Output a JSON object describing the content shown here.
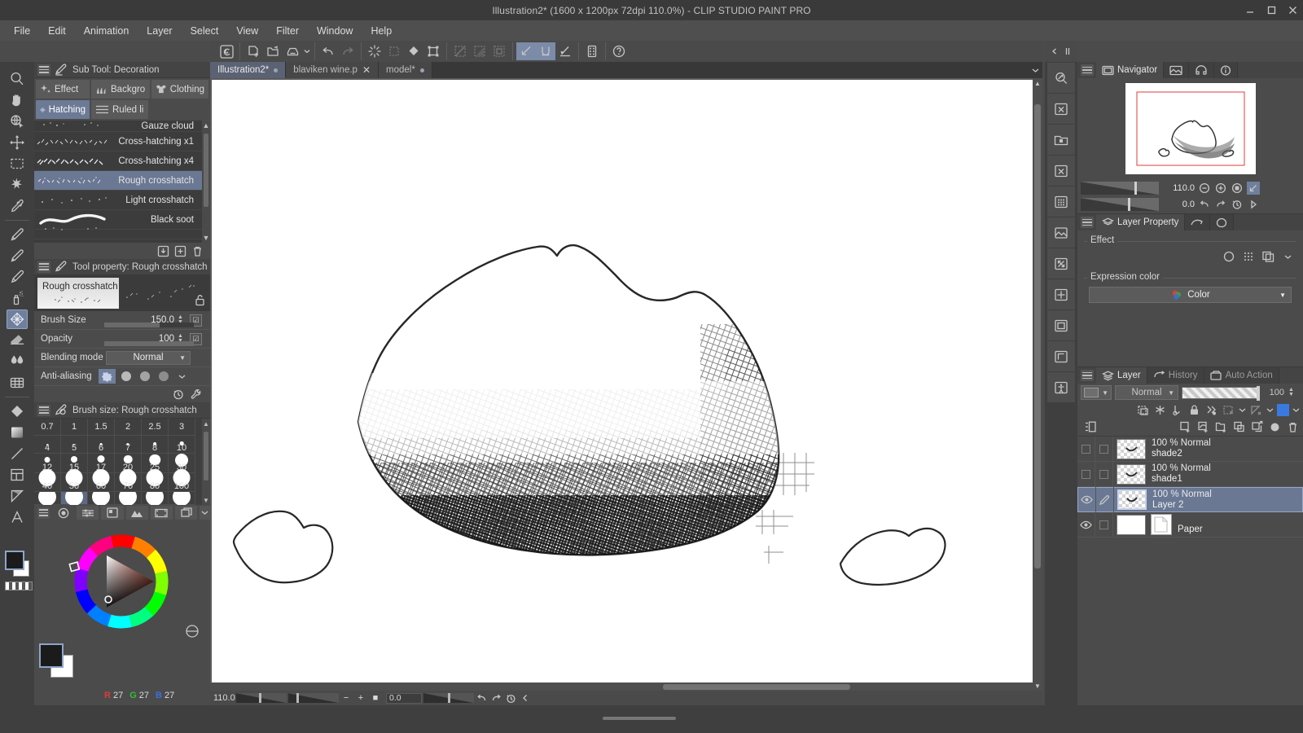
{
  "window": {
    "title": "Illustration2* (1600 x 1200px 72dpi 110.0%)  - CLIP STUDIO PAINT PRO",
    "minimize": "—",
    "maximize": "❐",
    "close": "✕"
  },
  "menubar": {
    "items": [
      "File",
      "Edit",
      "Animation",
      "Layer",
      "Select",
      "View",
      "Filter",
      "Window",
      "Help"
    ]
  },
  "doc_tabs": [
    {
      "label": "Illustration2*",
      "modified": true,
      "active": true,
      "closable": false
    },
    {
      "label": "blaviken wine.p",
      "modified": false,
      "active": false,
      "closable": true
    },
    {
      "label": "model*",
      "modified": true,
      "active": false,
      "closable": false
    }
  ],
  "command_bar": {
    "icons": [
      "clip-studio-logo-icon",
      "new-file-icon",
      "open-file-icon",
      "save-icon",
      "save-dropdown-caret-icon",
      "undo-icon",
      "redo-icon",
      "clear-icon",
      "fill-selection-icon",
      "fill-icon",
      "scale-rotate-icon",
      "selection-deselect-icon",
      "selection-invert-icon",
      "selection-border-icon",
      "select-layer-icon",
      "quick-mask-icon",
      "transparent-pixel-icon",
      "grid-icon",
      "help-icon"
    ]
  },
  "left_tools": {
    "items": [
      {
        "name": "zoom-tool",
        "icon": "magnifier-icon",
        "selected": false
      },
      {
        "name": "hand-tool",
        "icon": "hand-icon",
        "selected": false
      },
      {
        "name": "rotate-tool",
        "icon": "rotate-icon",
        "selected": false
      },
      {
        "name": "move-layer-tool",
        "icon": "move-arrows-icon",
        "selected": false
      },
      {
        "name": "selection-tool",
        "icon": "marquee-icon",
        "selected": false
      },
      {
        "name": "auto-select-tool",
        "icon": "magic-wand-icon",
        "selected": false
      },
      {
        "name": "eyedropper-tool",
        "icon": "eyedropper-icon",
        "selected": false
      },
      {
        "name": "pen-tool",
        "icon": "pen-icon",
        "selected": false
      },
      {
        "name": "pencil-tool",
        "icon": "pencil-icon",
        "selected": false
      },
      {
        "name": "brush-tool",
        "icon": "paintbrush-icon",
        "selected": false
      },
      {
        "name": "airbrush-tool",
        "icon": "airbrush-icon",
        "selected": false
      },
      {
        "name": "decoration-tool",
        "icon": "decoration-hatch-icon",
        "selected": true
      },
      {
        "name": "eraser-tool",
        "icon": "eraser-icon",
        "selected": false
      },
      {
        "name": "blend-tool",
        "icon": "blend-drops-icon",
        "selected": false
      },
      {
        "name": "gradient-tool",
        "icon": "gradient-grid-icon",
        "selected": false
      },
      {
        "name": "fill-tool",
        "icon": "fill-bucket-icon",
        "selected": false
      },
      {
        "name": "gradient-fill-tool",
        "icon": "gradient-square-icon",
        "selected": false
      },
      {
        "name": "figure-line-tool",
        "icon": "line-icon",
        "selected": false
      },
      {
        "name": "frame-border-tool",
        "icon": "frame-icon",
        "selected": false
      },
      {
        "name": "ruler-tool",
        "icon": "ruler-icon",
        "selected": false
      },
      {
        "name": "text-tool",
        "icon": "text-a-icon",
        "selected": false
      }
    ]
  },
  "subtool_panel": {
    "title": "Sub Tool: Decoration",
    "groups": [
      {
        "label": "Effect",
        "icon": "sparkle-icon",
        "selected": false
      },
      {
        "label": "Backgro",
        "icon": "grass-icon",
        "selected": false
      },
      {
        "label": "Clothing",
        "icon": "clothing-icon",
        "selected": false
      },
      {
        "label": "Hatching",
        "icon": "hatch-icon",
        "selected": true
      },
      {
        "label": "Ruled li",
        "icon": "ruled-lines-icon",
        "selected": false
      }
    ],
    "items": [
      {
        "label": "Gauze cloud",
        "selected": false,
        "partial": true
      },
      {
        "label": "Cross-hatching x1",
        "selected": false
      },
      {
        "label": "Cross-hatching x4",
        "selected": false
      },
      {
        "label": "Rough crosshatch",
        "selected": true
      },
      {
        "label": "Light crosshatch",
        "selected": false
      },
      {
        "label": "Black soot",
        "selected": false
      }
    ],
    "footer_icons": [
      "import-subtool-icon",
      "duplicate-subtool-icon",
      "delete-subtool-icon"
    ]
  },
  "tool_property": {
    "title": "Tool property: Rough crosshatch",
    "preview_label": "Rough crosshatch",
    "lock_icon": "lock-open-icon",
    "rows": [
      {
        "label": "Brush Size",
        "value": "150.0",
        "fill": 0.62,
        "type": "slider"
      },
      {
        "label": "Opacity",
        "value": "100",
        "fill": 1.0,
        "type": "slider"
      },
      {
        "label": "Blending mode",
        "value": "Normal",
        "type": "combo"
      },
      {
        "label": "Anti-aliasing",
        "type": "aa",
        "selected_index": 0
      }
    ],
    "footer_icons": [
      "history-reset-icon",
      "wrench-settings-icon"
    ]
  },
  "brush_size_panel": {
    "title": "Brush size: Rough crosshatch",
    "rows": [
      {
        "labels": [
          "0.7",
          "1",
          "1.5",
          "2",
          "2.5",
          "3"
        ],
        "dots": [
          0,
          0,
          0,
          0,
          0,
          0
        ],
        "text_only": true
      },
      {
        "labels": [
          "4",
          "5",
          "6",
          "7",
          "8",
          "10"
        ],
        "dots": [
          2,
          2.4,
          2.8,
          3.2,
          3.8,
          4.6
        ]
      },
      {
        "labels": [
          "12",
          "15",
          "17",
          "20",
          "25",
          "30"
        ],
        "dots": [
          7,
          8,
          9,
          10.5,
          13.5,
          16
        ]
      },
      {
        "labels": [
          "40",
          "50",
          "60",
          "70",
          "80",
          "100"
        ],
        "dots": [
          19,
          19,
          19,
          19,
          19,
          19
        ]
      },
      {
        "labels": [
          "",
          "",
          "",
          "",
          "",
          ""
        ],
        "dots": [
          19,
          19,
          19,
          19,
          19,
          19
        ],
        "selected_index": 1
      }
    ]
  },
  "color_panel": {
    "tabs": [
      "color-wheel-icon",
      "color-slider-icon",
      "color-set-icon",
      "gradient-icon",
      "filmstrip-icon",
      "layers-stack-icon"
    ],
    "main_color": "#000000",
    "sub_color": "#ffffff",
    "rgb": {
      "r": "27",
      "g": "27",
      "b": "27"
    },
    "rgb_labels": {
      "r": "R",
      "g": "G",
      "b": "B"
    }
  },
  "canvas": {
    "artwork_name": "hatched-rock-drawing",
    "background": "#ffffff"
  },
  "status_bar": {
    "zoom": "110.0",
    "rotation": "0.0",
    "minus": "−",
    "plus": "+",
    "fit": "■",
    "icons": [
      "rotate-left-icon",
      "rotate-right-icon",
      "reset-rotate-icon",
      "collapse-icon"
    ]
  },
  "right_toolbar": {
    "buttons": [
      "navigator-search-icon",
      "subview-close-icon",
      "material-folder-icon",
      "layer-close-icon",
      "material-grid-icon",
      "material-image-icon",
      "material-transform-icon",
      "material-stack-icon",
      "material-copy-icon",
      "material-dup-icon",
      "accessibility-icon"
    ]
  },
  "navigator": {
    "tabs": [
      {
        "label": "Navigator",
        "icon": "navigator-icon",
        "active": true
      },
      {
        "label": "",
        "icon": "subview-icon",
        "active": false
      },
      {
        "label": "",
        "icon": "item-bank-icon",
        "active": false
      },
      {
        "label": "",
        "icon": "info-icon",
        "active": false
      }
    ],
    "zoom_value": "110.0",
    "rotation_value": "0.0",
    "zoom_icons": [
      "zoom-out-icon",
      "zoom-in-icon",
      "fit-screen-icon",
      "flip-icon"
    ],
    "rot_icons": [
      "rotate-ccw-icon",
      "rotate-cw-icon",
      "reset-rotation-icon",
      "play-icon"
    ]
  },
  "layer_property": {
    "tabs": [
      {
        "label": "Layer Property",
        "icon": "layer-property-icon",
        "active": true
      },
      {
        "label": "",
        "icon": "animation-cels-icon",
        "active": false
      },
      {
        "label": "",
        "icon": "onion-skin-icon",
        "active": false
      }
    ],
    "effect_legend": "Effect",
    "effect_buttons": [
      "border-effect-icon",
      "tone-effect-icon",
      "layer-color-icon",
      "effect-dropdown-icon"
    ],
    "expression_legend": "Expression color",
    "expression_value": "Color",
    "expression_icon": "color-circles-icon"
  },
  "layer_panel": {
    "tabs": [
      {
        "label": "Layer",
        "icon": "layers-icon",
        "active": true
      },
      {
        "label": "History",
        "icon": "history-icon",
        "active": false
      },
      {
        "label": "Auto Action",
        "icon": "auto-action-icon",
        "active": false
      }
    ],
    "blend_mode": "Normal",
    "opacity": "100",
    "toolbar_icons_row1": [
      "clip-to-layer-icon",
      "mask-icon",
      "ruler-visible-icon",
      "lock-layer-icon",
      "lock-transparent-icon",
      "mask-enable-icon",
      "mask-dropdown-icon",
      "ruler-range-icon",
      "ruler-dropdown-icon",
      "palette-color-icon"
    ],
    "toolbar_icons_row2": [
      "list-view-icon",
      "new-raster-layer-icon",
      "new-vector-layer-icon",
      "new-folder-icon",
      "transfer-down-icon",
      "combine-down-icon",
      "layer-mask-icon",
      "delete-layer-icon"
    ],
    "layers": [
      {
        "name": "shade2",
        "mode": "100 % Normal",
        "visible": false,
        "selected": false,
        "has_pen": false
      },
      {
        "name": "shade1",
        "mode": "100 % Normal",
        "visible": false,
        "selected": false,
        "has_pen": false
      },
      {
        "name": "Layer 2",
        "mode": "100 % Normal",
        "visible": true,
        "selected": true,
        "has_pen": true
      },
      {
        "name": "Paper",
        "mode": "",
        "visible": true,
        "selected": false,
        "has_pen": false,
        "is_paper": true
      }
    ]
  }
}
